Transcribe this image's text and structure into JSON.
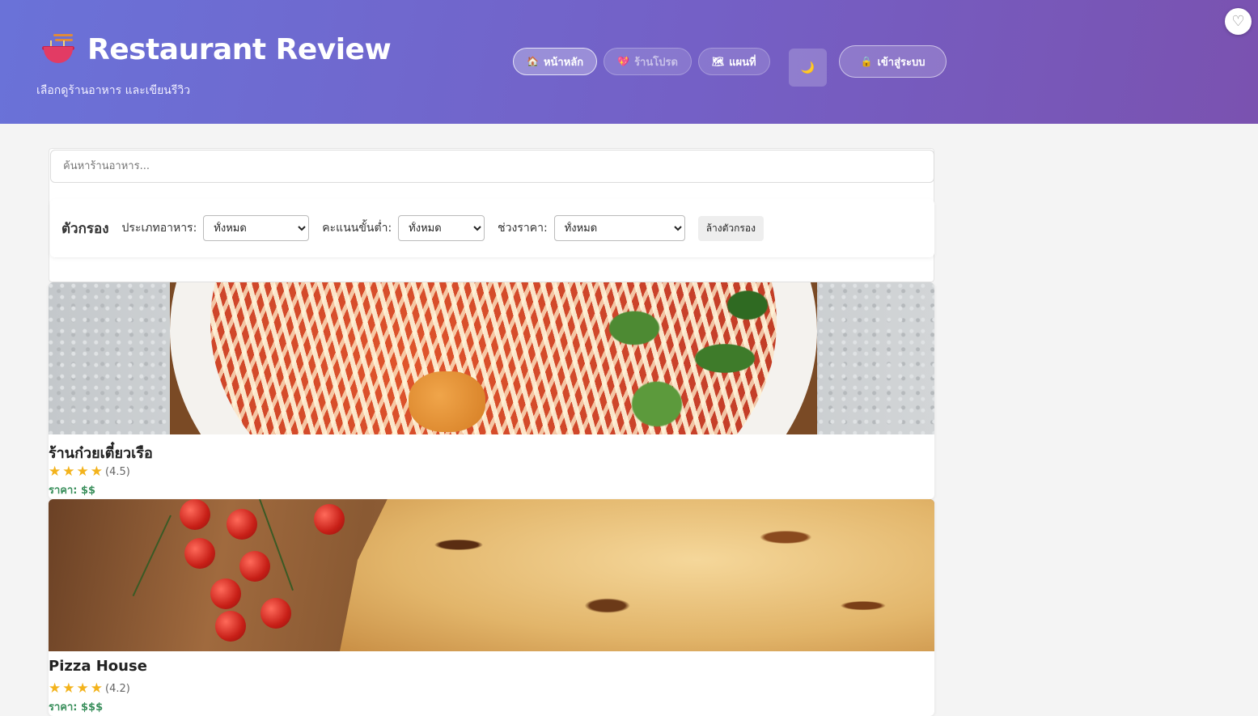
{
  "header": {
    "title": "Restaurant Review",
    "subtitle": "เลือกดูร้านอาหาร และเขียนรีวิว",
    "logo_icon": "noodle-bowl-icon",
    "nav": [
      {
        "label": "หน้าหลัก",
        "icon": "house-icon",
        "state": "active"
      },
      {
        "label": "ร้านโปรด",
        "icon": "heart-icon",
        "state": "dim"
      },
      {
        "label": "แผนที่",
        "icon": "map-icon",
        "state": "normal"
      }
    ],
    "theme_icon": "moon-icon",
    "login_label": "เข้าสู่ระบบ",
    "login_icon": "lock-icon",
    "favorite_icon": "heart-outline-icon"
  },
  "search": {
    "placeholder": "ค้นหาร้านอาหาร...",
    "value": ""
  },
  "filters": {
    "title": "ตัวกรอง",
    "food_type_label": "ประเภทอาหาร:",
    "food_type_value": "ทั้งหมด",
    "min_rating_label": "คะแนนขั้นต่ำ:",
    "min_rating_value": "ทั้งหมด",
    "price_range_label": "ช่วงราคา:",
    "price_range_value": "ทั้งหมด",
    "clear_label": "ล้างตัวกรอง"
  },
  "restaurants": [
    {
      "name": "ร้านก๋วยเตี๋ยวเรือ",
      "rating": 4.5,
      "rating_text": "(4.5)",
      "price_text": "ราคา: $$",
      "image": "noodle-soup-photo"
    },
    {
      "name": "Pizza House",
      "rating": 4.2,
      "rating_text": "(4.2)",
      "price_text": "ราคา: $$$",
      "image": "pizza-photo"
    }
  ],
  "colors": {
    "header_gradient_start": "#6a72d8",
    "header_gradient_end": "#7a52b0",
    "star": "#f3b31c",
    "price": "#3a8f5c"
  }
}
